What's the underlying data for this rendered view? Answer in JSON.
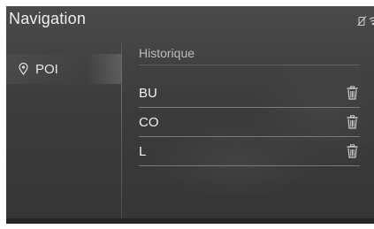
{
  "header": {
    "title": "Navigation",
    "status_icons": [
      "phone-no-signal-icon",
      "wifi-icon"
    ]
  },
  "sidebar": {
    "items": [
      {
        "label": "POI",
        "icon": "location-pin-icon"
      }
    ]
  },
  "main": {
    "section_title": "Historique",
    "history": [
      {
        "label": "BU",
        "icon": "trash-icon"
      },
      {
        "label": "CO",
        "icon": "trash-icon"
      },
      {
        "label": "L",
        "icon": "trash-icon"
      }
    ]
  },
  "colors": {
    "background": "#3f3f3f",
    "text": "#f0f0f0",
    "muted_text": "#bdbdbd",
    "divider": "#7a7a7a"
  }
}
